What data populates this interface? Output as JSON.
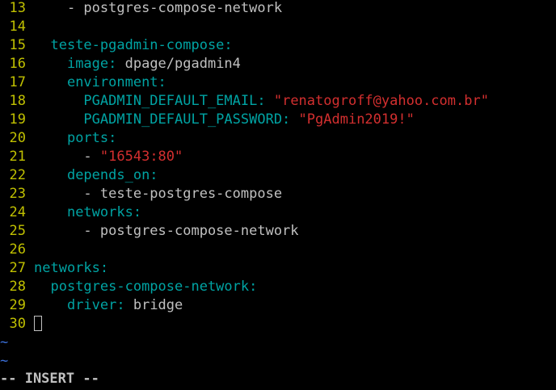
{
  "editor": {
    "lines": [
      {
        "num": "13",
        "indent": "    ",
        "parts": [
          {
            "c": "t",
            "v": "- postgres-compose-network"
          }
        ]
      },
      {
        "num": "14",
        "indent": "",
        "parts": []
      },
      {
        "num": "15",
        "indent": "  ",
        "parts": [
          {
            "c": "k",
            "v": "teste-pgadmin-compose:"
          }
        ]
      },
      {
        "num": "16",
        "indent": "    ",
        "parts": [
          {
            "c": "k",
            "v": "image:"
          },
          {
            "c": "t",
            "v": " dpage/pgadmin4"
          }
        ]
      },
      {
        "num": "17",
        "indent": "    ",
        "parts": [
          {
            "c": "k",
            "v": "environment:"
          }
        ]
      },
      {
        "num": "18",
        "indent": "      ",
        "parts": [
          {
            "c": "k",
            "v": "PGADMIN_DEFAULT_EMAIL:"
          },
          {
            "c": "t",
            "v": " "
          },
          {
            "c": "s",
            "v": "\"renatogroff@yahoo.com.br\""
          }
        ]
      },
      {
        "num": "19",
        "indent": "      ",
        "parts": [
          {
            "c": "k",
            "v": "PGADMIN_DEFAULT_PASSWORD:"
          },
          {
            "c": "t",
            "v": " "
          },
          {
            "c": "s",
            "v": "\"PgAdmin2019!\""
          }
        ]
      },
      {
        "num": "20",
        "indent": "    ",
        "parts": [
          {
            "c": "k",
            "v": "ports:"
          }
        ]
      },
      {
        "num": "21",
        "indent": "      ",
        "parts": [
          {
            "c": "t",
            "v": "- "
          },
          {
            "c": "s",
            "v": "\"16543:80\""
          }
        ]
      },
      {
        "num": "22",
        "indent": "    ",
        "parts": [
          {
            "c": "k",
            "v": "depends_on:"
          }
        ]
      },
      {
        "num": "23",
        "indent": "      ",
        "parts": [
          {
            "c": "t",
            "v": "- teste-postgres-compose"
          }
        ]
      },
      {
        "num": "24",
        "indent": "    ",
        "parts": [
          {
            "c": "k",
            "v": "networks:"
          }
        ]
      },
      {
        "num": "25",
        "indent": "      ",
        "parts": [
          {
            "c": "t",
            "v": "- postgres-compose-network"
          }
        ]
      },
      {
        "num": "26",
        "indent": "",
        "parts": []
      },
      {
        "num": "27",
        "indent": "",
        "parts": [
          {
            "c": "k",
            "v": "networks:"
          }
        ]
      },
      {
        "num": "28",
        "indent": "  ",
        "parts": [
          {
            "c": "k",
            "v": "postgres-compose-network:"
          }
        ]
      },
      {
        "num": "29",
        "indent": "    ",
        "parts": [
          {
            "c": "k",
            "v": "driver:"
          },
          {
            "c": "t",
            "v": " bridge"
          }
        ]
      },
      {
        "num": "30",
        "indent": "",
        "parts": [],
        "cursor": true
      }
    ],
    "empty_markers": [
      "~",
      "~"
    ],
    "mode_label": "-- INSERT --"
  },
  "colors": {
    "background": "#000000",
    "line_number": "#c0c000",
    "key": "#00a3a3",
    "string": "#d32f2f",
    "text": "#c0c0c0",
    "tilde": "#3b6fd8"
  }
}
